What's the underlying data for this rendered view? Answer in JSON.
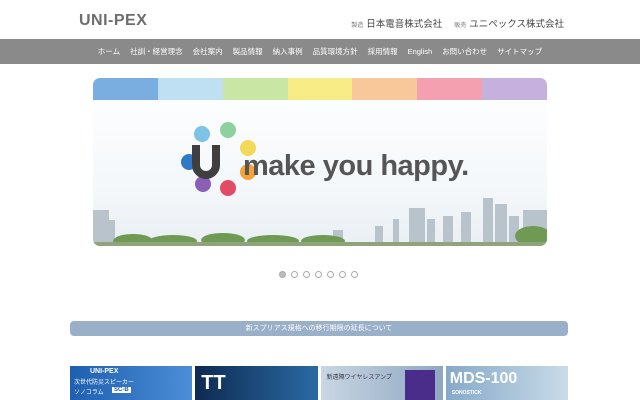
{
  "header": {
    "logo": "UNI-PEX",
    "maker_prefix": "製造",
    "maker_name": "日本電音株式会社",
    "seller_prefix": "販売",
    "seller_name": "ユニペックス株式会社"
  },
  "nav": {
    "items": [
      "ホーム",
      "社訓・経営理念",
      "会社案内",
      "製品情報",
      "納入事例",
      "品質環境方針",
      "採用情報",
      "English",
      "お問い合わせ",
      "サイトマップ"
    ]
  },
  "hero": {
    "tagline": "make you happy.",
    "band_colors": [
      "#7aaee0",
      "#bfe0f2",
      "#c9e6a5",
      "#f7ec86",
      "#f8c79a",
      "#f4a0b0",
      "#c6b1de"
    ],
    "logo_dot_colors": [
      "#7cc3e6",
      "#8fd19e",
      "#f3d95a",
      "#2f79c7",
      "#f5a23a",
      "#8a5fb5",
      "#e24b63"
    ]
  },
  "slider": {
    "dot_count": 7,
    "active_index": 0
  },
  "notice": {
    "text": "新スプリアス規格への移行期限の延長について"
  },
  "banners": [
    {
      "line1": "UNI-PEX",
      "line2": "次世代防災スピーカー",
      "line3": "ソノコラム",
      "line4": "SC-B"
    },
    {
      "line1": "TT"
    },
    {
      "line1": "新遠隔ワイヤレスアンプ"
    },
    {
      "line1": "MDS-100",
      "line2": "SONOSTICK"
    }
  ]
}
